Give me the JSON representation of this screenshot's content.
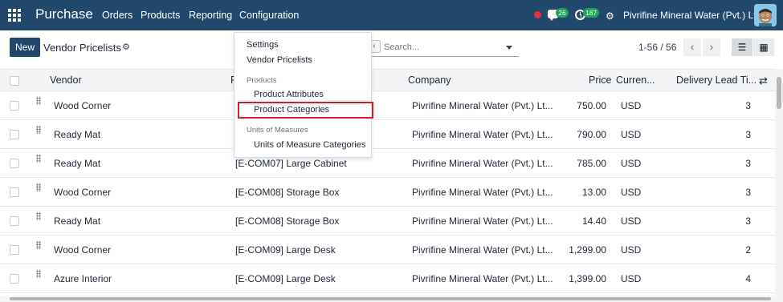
{
  "navbar": {
    "app_name": "Purchase",
    "menus": [
      "Orders",
      "Products",
      "Reporting",
      "Configuration"
    ],
    "chat_count": "26",
    "activity_count": "187",
    "company": "Pivrifine Mineral Water (Pvt.) Ltd."
  },
  "control": {
    "new_label": "New",
    "breadcrumb": "Vendor Pricelists",
    "search_placeholder": "Search...",
    "pager": "1-56 / 56"
  },
  "table": {
    "headers": {
      "vendor": "Vendor",
      "product": "P",
      "company": "Company",
      "price": "Price",
      "currency": "Curren...",
      "lead_time": "Delivery Lead Ti..."
    },
    "rows": [
      {
        "vendor": "Wood Corner",
        "product": "",
        "company": "Pivrifine Mineral Water (Pvt.) Lt...",
        "price": "750.00",
        "currency": "USD",
        "lead": "3"
      },
      {
        "vendor": "Ready Mat",
        "product": "",
        "company": "Pivrifine Mineral Water (Pvt.) Lt...",
        "price": "790.00",
        "currency": "USD",
        "lead": "3"
      },
      {
        "vendor": "Ready Mat",
        "product": "[E-COM07] Large Cabinet",
        "company": "Pivrifine Mineral Water (Pvt.) Lt...",
        "price": "785.00",
        "currency": "USD",
        "lead": "3"
      },
      {
        "vendor": "Wood Corner",
        "product": "[E-COM08] Storage Box",
        "company": "Pivrifine Mineral Water (Pvt.) Lt...",
        "price": "13.00",
        "currency": "USD",
        "lead": "3"
      },
      {
        "vendor": "Ready Mat",
        "product": "[E-COM08] Storage Box",
        "company": "Pivrifine Mineral Water (Pvt.) Lt...",
        "price": "14.40",
        "currency": "USD",
        "lead": "3"
      },
      {
        "vendor": "Wood Corner",
        "product": "[E-COM09] Large Desk",
        "company": "Pivrifine Mineral Water (Pvt.) Lt...",
        "price": "1,299.00",
        "currency": "USD",
        "lead": "2"
      },
      {
        "vendor": "Azure Interior",
        "product": "[E-COM09] Large Desk",
        "company": "Pivrifine Mineral Water (Pvt.) Lt...",
        "price": "1,399.00",
        "currency": "USD",
        "lead": "4"
      }
    ]
  },
  "dropdown": {
    "items": [
      "Settings",
      "Vendor Pricelists"
    ],
    "products_header": "Products",
    "products_items": [
      "Product Attributes",
      "Product Categories"
    ],
    "uom_header": "Units of Measures",
    "uom_items": [
      "Units of Measure Categories"
    ]
  },
  "colors": {
    "navbar": "#22486b",
    "highlight": "#d0202a",
    "badge": "#21a35a"
  }
}
